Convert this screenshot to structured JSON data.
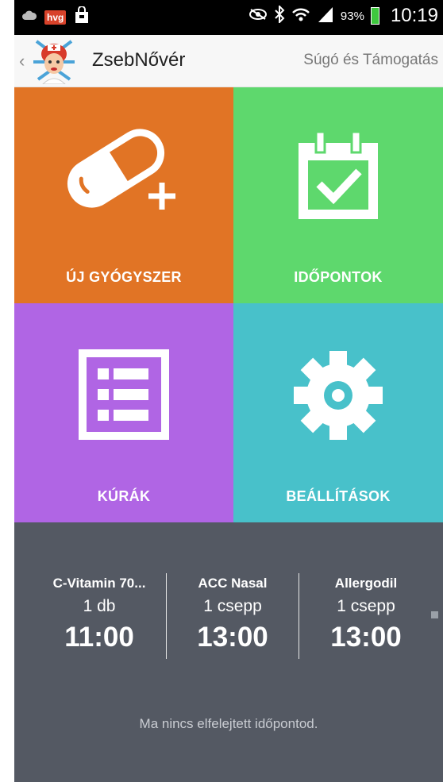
{
  "statusbar": {
    "hvg_label": "hvg",
    "battery_percent": "93%",
    "clock": "10:19",
    "icons": [
      "cloud-icon",
      "hvg-app-icon",
      "shopping-bag-icon",
      "eye-icon",
      "bluetooth-icon",
      "wifi-icon",
      "signal-icon",
      "battery-icon"
    ]
  },
  "appbar": {
    "title": "ZsebNővér",
    "help_link": "Súgó és Támogatás"
  },
  "tiles": [
    {
      "label": "ÚJ GYÓGYSZER",
      "color": "#e17425",
      "icon": "pill-plus-icon"
    },
    {
      "label": "IDŐPONTOK",
      "color": "#5ed86d",
      "icon": "calendar-check-icon"
    },
    {
      "label": "KÚRÁK",
      "color": "#b065e4",
      "icon": "list-icon"
    },
    {
      "label": "BEÁLLÍTÁSOK",
      "color": "#48c1ca",
      "icon": "gear-icon"
    }
  ],
  "medications": [
    {
      "name": "C-Vitamin 70...",
      "dose": "1 db",
      "time": "11:00"
    },
    {
      "name": "ACC Nasal",
      "dose": "1 csepp",
      "time": "13:00"
    },
    {
      "name": "Allergodil",
      "dose": "1 csepp",
      "time": "13:00"
    }
  ],
  "status_message": "Ma nincs elfelejtett időpontod.",
  "colors": {
    "panel_bg": "#545963",
    "statusbar_bg": "#000000"
  }
}
